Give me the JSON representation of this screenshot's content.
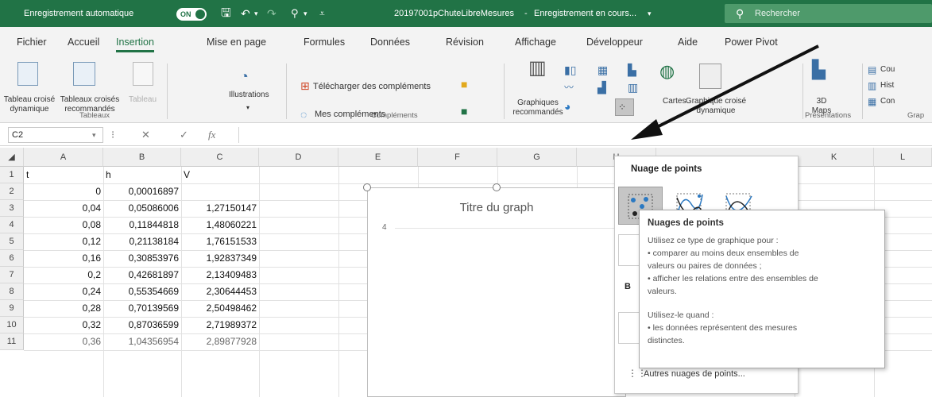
{
  "titlebar": {
    "autosave_label": "Enregistrement automatique",
    "toggle_label": "ON",
    "filename": "20197001pChuteLibreMesures",
    "status": "Enregistrement en cours...",
    "search_placeholder": "Rechercher"
  },
  "tabs": [
    "Fichier",
    "Accueil",
    "Insertion",
    "Mise en page",
    "Formules",
    "Données",
    "Révision",
    "Affichage",
    "Développeur",
    "Aide",
    "Power Pivot"
  ],
  "active_tab": "Insertion",
  "ribbon": {
    "tableaux": {
      "pivot_table": [
        "Tableau croisé",
        "dynamique"
      ],
      "recommended_pivot": [
        "Tableaux croisés",
        "recommandés"
      ],
      "table": "Tableau",
      "group_label": "Tableaux"
    },
    "illustrations": {
      "label": "Illustrations"
    },
    "complements": {
      "get_addins": "Télécharger des compléments",
      "my_addins": "Mes compléments",
      "group_label": "Compléments"
    },
    "graphiques": {
      "recommended": [
        "Graphiques",
        "recommandés"
      ],
      "maps": "Cartes",
      "pivot_chart": [
        "Graphique croisé",
        "dynamique"
      ]
    },
    "presentations": {
      "maps3d": [
        "3D",
        "Maps"
      ],
      "group_label": "Présentations"
    },
    "partial": [
      "Cou",
      "Hist",
      "Con",
      "Grap"
    ]
  },
  "formula_bar": {
    "cell_ref": "C2",
    "fx_label": "fx"
  },
  "grid": {
    "columns": [
      "A",
      "B",
      "C",
      "D",
      "E",
      "F",
      "G",
      "H",
      "K",
      "L"
    ],
    "rows": [
      {
        "n": "1",
        "a": "t",
        "b": "h",
        "c": "V"
      },
      {
        "n": "2",
        "a": "0",
        "b": "0,00016897",
        "c": ""
      },
      {
        "n": "3",
        "a": "0,04",
        "b": "0,05086006",
        "c": "1,27150147"
      },
      {
        "n": "4",
        "a": "0,08",
        "b": "0,11844818",
        "c": "1,48060221"
      },
      {
        "n": "5",
        "a": "0,12",
        "b": "0,21138184",
        "c": "1,76151533"
      },
      {
        "n": "6",
        "a": "0,16",
        "b": "0,30853976",
        "c": "1,92837349"
      },
      {
        "n": "7",
        "a": "0,2",
        "b": "0,42681897",
        "c": "2,13409483"
      },
      {
        "n": "8",
        "a": "0,24",
        "b": "0,55354669",
        "c": "2,30644453"
      },
      {
        "n": "9",
        "a": "0,28",
        "b": "0,70139569",
        "c": "2,50498462"
      },
      {
        "n": "10",
        "a": "0,32",
        "b": "0,87036599",
        "c": "2,71989372"
      },
      {
        "n": "11",
        "a": "0,36",
        "b": "1,04356954",
        "c": "2,89877928"
      }
    ]
  },
  "chart": {
    "title": "Titre du graph",
    "axis_tick": "4"
  },
  "dropdown": {
    "title": "Nuage de points",
    "side_letters": [
      "B"
    ],
    "more_label": "Autres nuages de points..."
  },
  "tooltip": {
    "title": "Nuages de points",
    "lines": [
      "Utilisez ce type de graphique pour :",
      "• comparer au moins deux ensembles de",
      "valeurs ou paires de données ;",
      "• afficher les relations entre des ensembles de",
      "valeurs.",
      "",
      "Utilisez-le quand :",
      "• les données représentent des mesures",
      "distinctes."
    ]
  },
  "colors": {
    "excel_green": "#217346",
    "ribbon_bg": "#f3f3f3",
    "accent_blue": "#3a6fa5"
  }
}
